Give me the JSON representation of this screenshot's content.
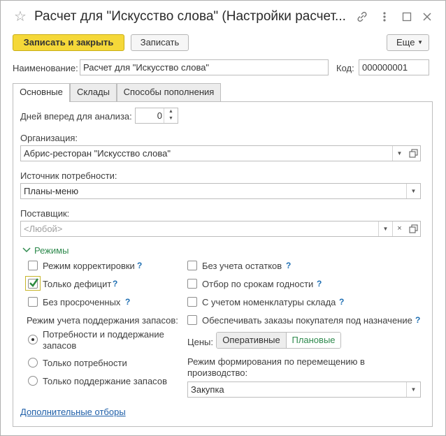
{
  "window": {
    "title": "Расчет для \"Искусство слова\" (Настройки расчет...",
    "star_icon": "☆",
    "link_icon": "🔗",
    "menu_icon": "⋮",
    "minimize_icon": "□",
    "close_icon": "✕"
  },
  "toolbar": {
    "save_close_label": "Записать и закрыть",
    "save_label": "Записать",
    "more_label": "Еще"
  },
  "header": {
    "name_label": "Наименование:",
    "name_value": "Расчет для \"Искусство слова\"",
    "code_label": "Код:",
    "code_value": "000000001"
  },
  "tabs": [
    {
      "label": "Основные"
    },
    {
      "label": "Склады"
    },
    {
      "label": "Способы пополнения"
    }
  ],
  "main": {
    "days_label": "Дней вперед для анализа:",
    "days_value": "0",
    "org_label": "Организация:",
    "org_value": "Абрис-ресторан \"Искусство слова\"",
    "source_label": "Источник потребности:",
    "source_value": "Планы-меню",
    "supplier_label": "Поставщик:",
    "supplier_placeholder": "<Любой>",
    "modes_label": "Режимы",
    "left_checks": [
      {
        "label": "Режим корректировки",
        "checked": false
      },
      {
        "label": "Только дефицит",
        "checked": true
      },
      {
        "label": "Без просроченных",
        "checked": false
      }
    ],
    "right_checks": [
      {
        "label": "Без учета остатков",
        "checked": false
      },
      {
        "label": "Отбор по срокам годности",
        "checked": false
      },
      {
        "label": "С учетом номенклатуры склада",
        "checked": false
      },
      {
        "label": "Обеспечивать заказы покупателя под назначение",
        "checked": false
      }
    ],
    "help_mark": "?",
    "stock_mode_label": "Режим учета поддержания запасов:",
    "radios": [
      {
        "label_line1": "Потребности и поддержание",
        "label_line2": "запасов",
        "selected": true
      },
      {
        "label_line1": "Только потребности",
        "label_line2": "",
        "selected": false
      },
      {
        "label_line1": "Только поддержание запасов",
        "label_line2": "",
        "selected": false
      }
    ],
    "prices_label": "Цены:",
    "price_options": [
      "Оперативные",
      "Плановые"
    ],
    "transfer_label_line1": "Режим формирования по перемещению в",
    "transfer_label_line2": "производство:",
    "transfer_value": "Закупка",
    "extra_filters_link": "Дополнительные отборы"
  },
  "colors": {
    "primary_button": "#f5d839",
    "accent_green": "#2f8a4e",
    "link_blue": "#1f5fa8"
  }
}
